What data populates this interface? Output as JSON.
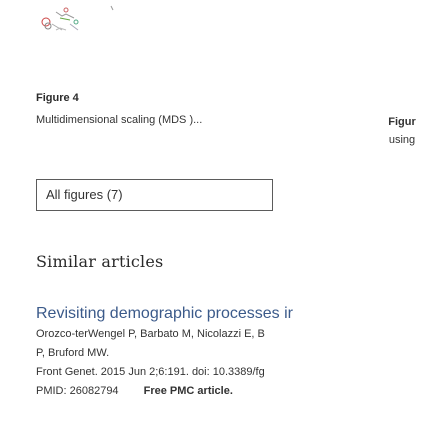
{
  "figure4": {
    "title": "Figure 4",
    "caption": "Multidimensional scaling (MDS )..."
  },
  "figure5": {
    "title": "Figur",
    "caption": "using"
  },
  "all_figures_button": "All figures (7)",
  "similar_articles": {
    "heading": "Similar articles",
    "items": [
      {
        "title": "Revisiting demographic processes ir",
        "authors": "Orozco-terWengel P, Barbato M, Nicolazzi E, B",
        "authors_line2": "P, Bruford MW.",
        "citation": "Front Genet. 2015 Jun 2;6:191. doi: 10.3389/fg",
        "pmid": "PMID: 26082794",
        "badge": "Free PMC article."
      }
    ]
  }
}
